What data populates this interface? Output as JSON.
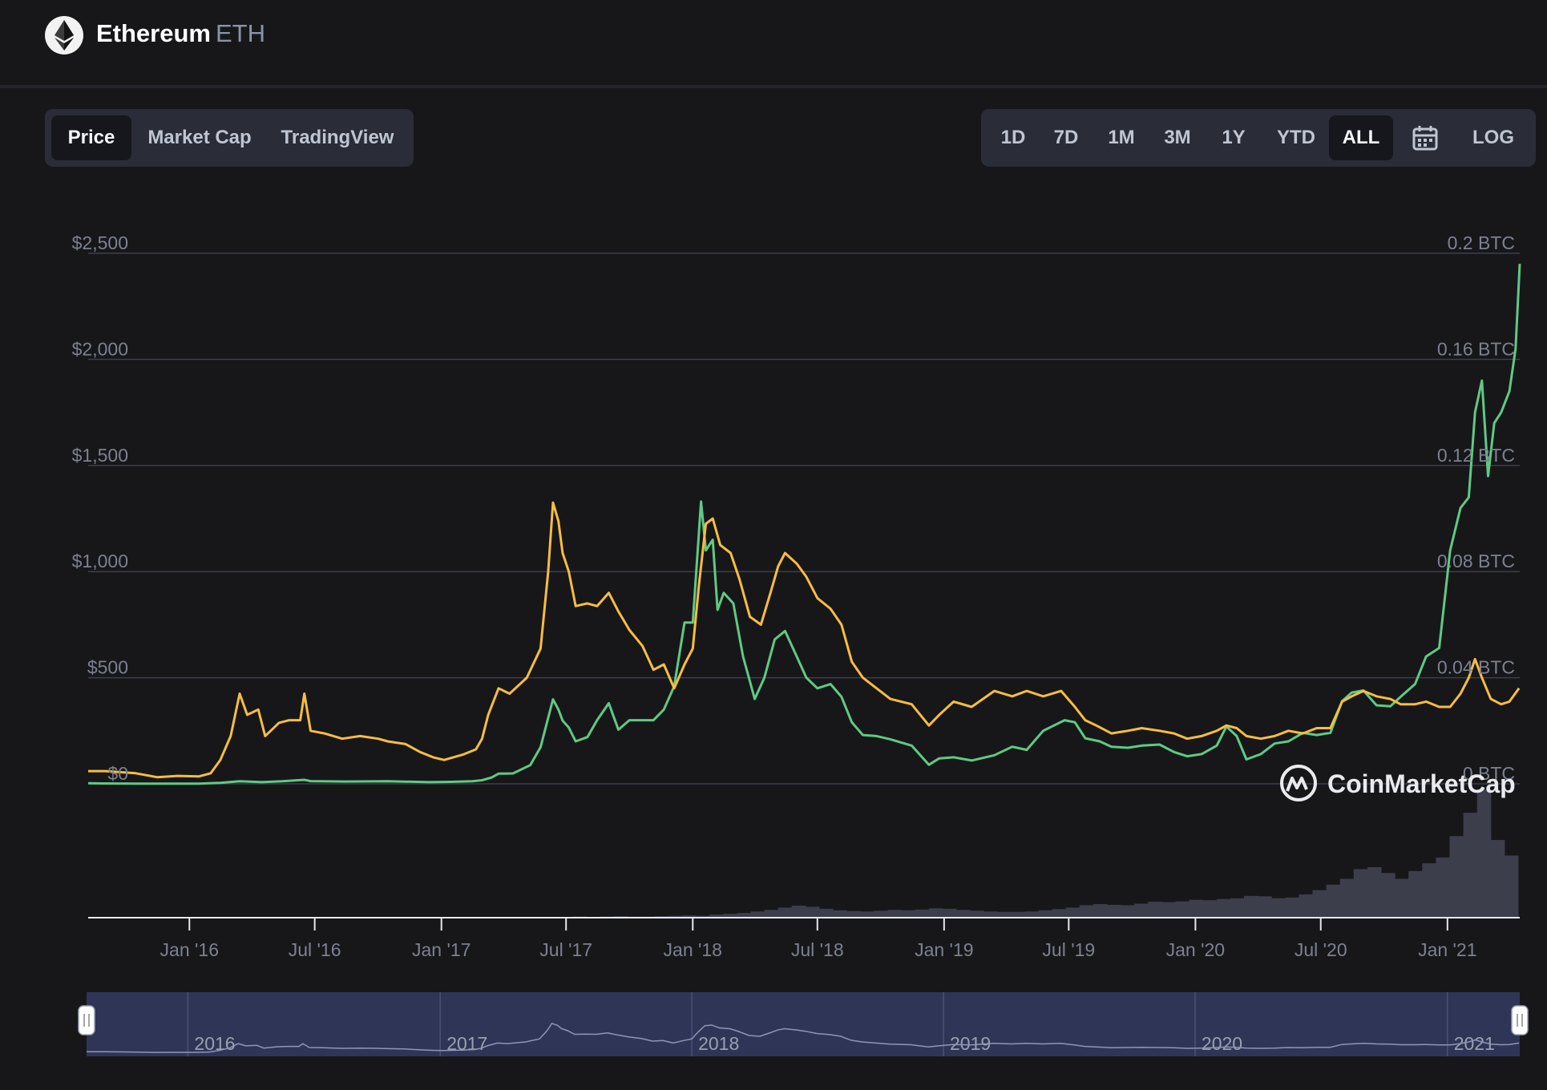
{
  "header": {
    "name": "Ethereum",
    "symbol": "ETH"
  },
  "tabs": [
    {
      "label": "Price",
      "active": true
    },
    {
      "label": "Market Cap",
      "active": false
    },
    {
      "label": "TradingView",
      "active": false
    }
  ],
  "ranges": [
    {
      "label": "1D",
      "active": false
    },
    {
      "label": "7D",
      "active": false
    },
    {
      "label": "1M",
      "active": false
    },
    {
      "label": "3M",
      "active": false
    },
    {
      "label": "1Y",
      "active": false
    },
    {
      "label": "YTD",
      "active": false
    },
    {
      "label": "ALL",
      "active": true
    }
  ],
  "log_label": "LOG",
  "watermark": "CoinMarketCap",
  "navigator": {
    "years": [
      "2016",
      "2017",
      "2018",
      "2019",
      "2020",
      "2021"
    ]
  },
  "colors": {
    "usd_line": "#f7bd41",
    "btc_line": "#5fca83",
    "grid": "#3b3e4c",
    "volume": "#3c3e4c",
    "navigator_bg": "#2f3556"
  },
  "chart_data": {
    "type": "line",
    "y_left": {
      "ticks": [
        "$0",
        "$500",
        "$1,000",
        "$1,500",
        "$2,000",
        "$2,500"
      ],
      "range": [
        0,
        2500
      ]
    },
    "y_right": {
      "ticks": [
        "0 BTC",
        "0.04 BTC",
        "0.08 BTC",
        "0.12 BTC",
        "0.16 BTC",
        "0.2 BTC"
      ],
      "range": [
        0,
        0.2
      ]
    },
    "x_ticks": [
      "Jan '16",
      "Jul '16",
      "Jan '17",
      "Jul '17",
      "Jan '18",
      "Jul '18",
      "Jan '19",
      "Jul '19",
      "Jan '20",
      "Jul '20",
      "Jan '21"
    ],
    "series": [
      {
        "axis": "right",
        "unit": "BTC",
        "points": [
          [
            "2015-08-07",
            0.0048
          ],
          [
            "2015-09-01",
            0.0048
          ],
          [
            "2015-10-15",
            0.004
          ],
          [
            "2015-11-15",
            0.0025
          ],
          [
            "2015-12-15",
            0.003
          ],
          [
            "2016-01-15",
            0.0028
          ],
          [
            "2016-02-01",
            0.004
          ],
          [
            "2016-02-15",
            0.009
          ],
          [
            "2016-03-01",
            0.018
          ],
          [
            "2016-03-14",
            0.034
          ],
          [
            "2016-03-25",
            0.026
          ],
          [
            "2016-04-10",
            0.028
          ],
          [
            "2016-04-20",
            0.018
          ],
          [
            "2016-05-10",
            0.023
          ],
          [
            "2016-05-25",
            0.024
          ],
          [
            "2016-06-10",
            0.024
          ],
          [
            "2016-06-16",
            0.034
          ],
          [
            "2016-06-25",
            0.02
          ],
          [
            "2016-07-15",
            0.019
          ],
          [
            "2016-08-10",
            0.017
          ],
          [
            "2016-09-05",
            0.018
          ],
          [
            "2016-10-01",
            0.017
          ],
          [
            "2016-10-15",
            0.016
          ],
          [
            "2016-11-10",
            0.015
          ],
          [
            "2016-12-01",
            0.012
          ],
          [
            "2016-12-20",
            0.01
          ],
          [
            "2017-01-05",
            0.009
          ],
          [
            "2017-02-01",
            0.011
          ],
          [
            "2017-02-20",
            0.013
          ],
          [
            "2017-03-01",
            0.017
          ],
          [
            "2017-03-10",
            0.026
          ],
          [
            "2017-03-25",
            0.036
          ],
          [
            "2017-04-10",
            0.034
          ],
          [
            "2017-05-05",
            0.04
          ],
          [
            "2017-05-25",
            0.051
          ],
          [
            "2017-06-05",
            0.08
          ],
          [
            "2017-06-12",
            0.106
          ],
          [
            "2017-06-20",
            0.099
          ],
          [
            "2017-06-26",
            0.087
          ],
          [
            "2017-07-05",
            0.08
          ],
          [
            "2017-07-15",
            0.067
          ],
          [
            "2017-08-01",
            0.068
          ],
          [
            "2017-08-15",
            0.067
          ],
          [
            "2017-09-01",
            0.072
          ],
          [
            "2017-09-15",
            0.065
          ],
          [
            "2017-10-01",
            0.058
          ],
          [
            "2017-10-20",
            0.052
          ],
          [
            "2017-11-05",
            0.043
          ],
          [
            "2017-11-20",
            0.045
          ],
          [
            "2017-12-05",
            0.036
          ],
          [
            "2017-12-20",
            0.045
          ],
          [
            "2018-01-01",
            0.051
          ],
          [
            "2018-01-10",
            0.075
          ],
          [
            "2018-01-20",
            0.098
          ],
          [
            "2018-01-30",
            0.1
          ],
          [
            "2018-02-10",
            0.09
          ],
          [
            "2018-02-25",
            0.087
          ],
          [
            "2018-03-10",
            0.077
          ],
          [
            "2018-03-25",
            0.063
          ],
          [
            "2018-04-10",
            0.06
          ],
          [
            "2018-04-25",
            0.073
          ],
          [
            "2018-05-05",
            0.082
          ],
          [
            "2018-05-15",
            0.087
          ],
          [
            "2018-06-01",
            0.083
          ],
          [
            "2018-06-15",
            0.078
          ],
          [
            "2018-07-01",
            0.07
          ],
          [
            "2018-07-20",
            0.066
          ],
          [
            "2018-08-05",
            0.06
          ],
          [
            "2018-08-20",
            0.046
          ],
          [
            "2018-09-05",
            0.04
          ],
          [
            "2018-09-25",
            0.036
          ],
          [
            "2018-10-15",
            0.032
          ],
          [
            "2018-11-15",
            0.03
          ],
          [
            "2018-12-10",
            0.022
          ],
          [
            "2018-12-25",
            0.026
          ],
          [
            "2019-01-15",
            0.031
          ],
          [
            "2019-02-10",
            0.029
          ],
          [
            "2019-03-15",
            0.035
          ],
          [
            "2019-04-10",
            0.033
          ],
          [
            "2019-05-01",
            0.035
          ],
          [
            "2019-05-25",
            0.033
          ],
          [
            "2019-06-20",
            0.035
          ],
          [
            "2019-07-10",
            0.029
          ],
          [
            "2019-07-25",
            0.024
          ],
          [
            "2019-08-10",
            0.022
          ],
          [
            "2019-09-01",
            0.019
          ],
          [
            "2019-09-25",
            0.02
          ],
          [
            "2019-10-15",
            0.021
          ],
          [
            "2019-11-10",
            0.02
          ],
          [
            "2019-12-01",
            0.019
          ],
          [
            "2019-12-20",
            0.017
          ],
          [
            "2020-01-10",
            0.018
          ],
          [
            "2020-02-01",
            0.02
          ],
          [
            "2020-02-15",
            0.022
          ],
          [
            "2020-03-01",
            0.021
          ],
          [
            "2020-03-15",
            0.018
          ],
          [
            "2020-04-05",
            0.017
          ],
          [
            "2020-04-25",
            0.018
          ],
          [
            "2020-05-15",
            0.02
          ],
          [
            "2020-06-05",
            0.019
          ],
          [
            "2020-06-25",
            0.021
          ],
          [
            "2020-07-15",
            0.021
          ],
          [
            "2020-08-01",
            0.031
          ],
          [
            "2020-08-15",
            0.033
          ],
          [
            "2020-09-01",
            0.035
          ],
          [
            "2020-09-20",
            0.033
          ],
          [
            "2020-10-10",
            0.032
          ],
          [
            "2020-10-25",
            0.03
          ],
          [
            "2020-11-15",
            0.03
          ],
          [
            "2020-12-01",
            0.031
          ],
          [
            "2020-12-20",
            0.029
          ],
          [
            "2021-01-05",
            0.029
          ],
          [
            "2021-01-20",
            0.034
          ],
          [
            "2021-02-01",
            0.04
          ],
          [
            "2021-02-10",
            0.047
          ],
          [
            "2021-02-20",
            0.04
          ],
          [
            "2021-03-05",
            0.032
          ],
          [
            "2021-03-20",
            0.03
          ],
          [
            "2021-04-01",
            0.031
          ],
          [
            "2021-04-15",
            0.036
          ]
        ]
      },
      {
        "axis": "left",
        "unit": "USD",
        "points": [
          [
            "2015-08-07",
            2.8
          ],
          [
            "2015-10-15",
            0.9
          ],
          [
            "2015-12-15",
            0.9
          ],
          [
            "2016-01-15",
            1.1
          ],
          [
            "2016-02-15",
            5
          ],
          [
            "2016-03-14",
            12
          ],
          [
            "2016-04-15",
            8
          ],
          [
            "2016-05-15",
            12
          ],
          [
            "2016-06-16",
            19
          ],
          [
            "2016-06-25",
            13
          ],
          [
            "2016-08-15",
            11
          ],
          [
            "2016-10-15",
            12
          ],
          [
            "2016-12-15",
            8
          ],
          [
            "2017-01-15",
            9.5
          ],
          [
            "2017-02-15",
            12
          ],
          [
            "2017-03-01",
            17
          ],
          [
            "2017-03-15",
            30
          ],
          [
            "2017-03-25",
            48
          ],
          [
            "2017-04-15",
            49
          ],
          [
            "2017-05-10",
            88
          ],
          [
            "2017-05-25",
            173
          ],
          [
            "2017-06-12",
            398
          ],
          [
            "2017-06-20",
            350
          ],
          [
            "2017-06-26",
            298
          ],
          [
            "2017-07-05",
            265
          ],
          [
            "2017-07-15",
            200
          ],
          [
            "2017-08-01",
            220
          ],
          [
            "2017-08-15",
            300
          ],
          [
            "2017-09-01",
            380
          ],
          [
            "2017-09-15",
            255
          ],
          [
            "2017-10-01",
            300
          ],
          [
            "2017-10-20",
            300
          ],
          [
            "2017-11-05",
            300
          ],
          [
            "2017-11-20",
            350
          ],
          [
            "2017-12-05",
            460
          ],
          [
            "2017-12-20",
            760
          ],
          [
            "2018-01-01",
            760
          ],
          [
            "2018-01-13",
            1330
          ],
          [
            "2018-01-20",
            1100
          ],
          [
            "2018-01-30",
            1150
          ],
          [
            "2018-02-06",
            820
          ],
          [
            "2018-02-15",
            900
          ],
          [
            "2018-03-01",
            850
          ],
          [
            "2018-03-15",
            600
          ],
          [
            "2018-04-01",
            400
          ],
          [
            "2018-04-15",
            500
          ],
          [
            "2018-04-30",
            680
          ],
          [
            "2018-05-15",
            720
          ],
          [
            "2018-06-01",
            600
          ],
          [
            "2018-06-15",
            500
          ],
          [
            "2018-07-01",
            450
          ],
          [
            "2018-07-20",
            470
          ],
          [
            "2018-08-05",
            410
          ],
          [
            "2018-08-20",
            290
          ],
          [
            "2018-09-05",
            230
          ],
          [
            "2018-09-25",
            225
          ],
          [
            "2018-10-15",
            210
          ],
          [
            "2018-11-15",
            180
          ],
          [
            "2018-12-10",
            90
          ],
          [
            "2018-12-25",
            120
          ],
          [
            "2019-01-15",
            125
          ],
          [
            "2019-02-10",
            110
          ],
          [
            "2019-03-15",
            135
          ],
          [
            "2019-04-10",
            175
          ],
          [
            "2019-05-01",
            160
          ],
          [
            "2019-05-25",
            250
          ],
          [
            "2019-06-25",
            300
          ],
          [
            "2019-07-10",
            290
          ],
          [
            "2019-07-25",
            215
          ],
          [
            "2019-08-15",
            200
          ],
          [
            "2019-09-01",
            175
          ],
          [
            "2019-09-25",
            170
          ],
          [
            "2019-10-15",
            180
          ],
          [
            "2019-11-10",
            185
          ],
          [
            "2019-12-01",
            150
          ],
          [
            "2019-12-20",
            130
          ],
          [
            "2020-01-10",
            140
          ],
          [
            "2020-02-01",
            180
          ],
          [
            "2020-02-15",
            270
          ],
          [
            "2020-03-01",
            225
          ],
          [
            "2020-03-15",
            115
          ],
          [
            "2020-04-05",
            140
          ],
          [
            "2020-04-25",
            190
          ],
          [
            "2020-05-15",
            200
          ],
          [
            "2020-06-05",
            240
          ],
          [
            "2020-06-25",
            230
          ],
          [
            "2020-07-15",
            240
          ],
          [
            "2020-08-01",
            390
          ],
          [
            "2020-08-15",
            430
          ],
          [
            "2020-09-01",
            440
          ],
          [
            "2020-09-20",
            370
          ],
          [
            "2020-10-10",
            365
          ],
          [
            "2020-10-25",
            410
          ],
          [
            "2020-11-15",
            470
          ],
          [
            "2020-12-01",
            600
          ],
          [
            "2020-12-20",
            640
          ],
          [
            "2021-01-05",
            1100
          ],
          [
            "2021-01-20",
            1300
          ],
          [
            "2021-02-01",
            1350
          ],
          [
            "2021-02-10",
            1750
          ],
          [
            "2021-02-20",
            1900
          ],
          [
            "2021-03-01",
            1450
          ],
          [
            "2021-03-10",
            1700
          ],
          [
            "2021-03-20",
            1750
          ],
          [
            "2021-04-01",
            1850
          ],
          [
            "2021-04-10",
            2050
          ],
          [
            "2021-04-16",
            2450
          ]
        ]
      }
    ],
    "volume": [
      0.2,
      0.2,
      0.3,
      0.2,
      0.3,
      0.4,
      0.3,
      0.3,
      0.4,
      0.5,
      0.6,
      0.5,
      0.8,
      1.0,
      1.2,
      1.6,
      2.0,
      2.6,
      3.1,
      2.8,
      2.3,
      1.9,
      1.7,
      1.6,
      1.8,
      2.0,
      1.9,
      2.1,
      2.4,
      2.3,
      2.0,
      1.8,
      1.6,
      1.5,
      1.5,
      1.6,
      1.9,
      2.2,
      2.6,
      3.2,
      3.5,
      3.3,
      3.2,
      3.6,
      4.1,
      4.0,
      4.2,
      4.6,
      4.5,
      4.8,
      5.0,
      5.6,
      5.5,
      5.0,
      5.2,
      6.0,
      7.1,
      8.5,
      10.0,
      12.5,
      13.0,
      11.5,
      10.0,
      12.0,
      14.0,
      15.5,
      21.0,
      27.0,
      33.0,
      20.0,
      16.0
    ]
  }
}
